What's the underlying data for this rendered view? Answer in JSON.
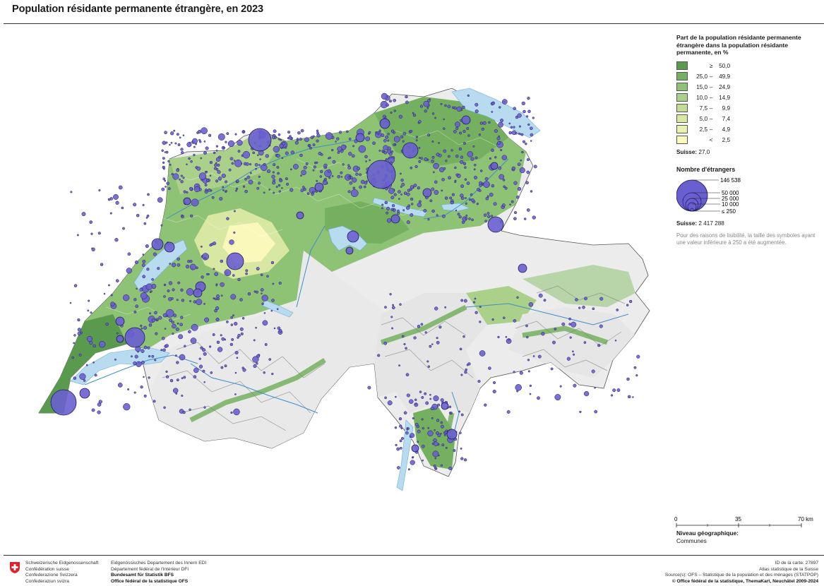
{
  "title": "Population résidante permanente étrangère, en 2023",
  "legend_share": {
    "title": "Part de la population résidante permanente étrangère dans la population résidante permanente, en %",
    "classes": [
      {
        "a": "",
        "op": "≥",
        "b": "50,0",
        "color": "#5a9a4e"
      },
      {
        "a": "25,0",
        "op": "–",
        "b": "49,9",
        "color": "#74b05f"
      },
      {
        "a": "15,0",
        "op": "–",
        "b": "24,9",
        "color": "#8ec274"
      },
      {
        "a": "10,0",
        "op": "–",
        "b": "14,9",
        "color": "#aad08a"
      },
      {
        "a": "7,5",
        "op": "–",
        "b": "9,9",
        "color": "#c4dc98"
      },
      {
        "a": "5,0",
        "op": "–",
        "b": "7,4",
        "color": "#d8e7a2"
      },
      {
        "a": "2,5",
        "op": "–",
        "b": "4,9",
        "color": "#eaf1ad"
      },
      {
        "a": "",
        "op": "<",
        "b": "2,5",
        "color": "#fbf8bc"
      }
    ],
    "total_label": "Suisse:",
    "total_value": "27,0"
  },
  "legend_count": {
    "title": "Nombre d'étrangers",
    "values": [
      "146 538",
      "50 000",
      "25 000",
      "10 000",
      "≤ 250"
    ],
    "total_label": "Suisse:",
    "total_value": "2 417 288",
    "note": "Pour des raisons de lisibilité, la taille des symboles ayant une valeur inférieure à 250 a été augmentée."
  },
  "scale": {
    "ticks": [
      "0",
      "35",
      "70 km"
    ]
  },
  "niveau": {
    "title": "Niveau géographique:",
    "value": "Communes"
  },
  "footer": {
    "col1": [
      "Schweizerische Eidgenossenschaft",
      "Confédération suisse",
      "Confederazione Svizzera",
      "Confederaziun svizra"
    ],
    "col2": [
      "Eidgenössisches Departement des Innern EDI",
      "Département fédéral de l'intérieur DFI",
      "Bundesamt für Statistik BFS",
      "Office fédéral de la statistique OFS"
    ],
    "right": [
      "ID de la carte: 27897",
      "Atlas statistique de la Suisse",
      "Source(s): OFS – Statistique de la population et des ménages (STATPOP)",
      "© Office fédéral de la statistique, ThemaKart, Neuchâtel 2009-2024"
    ]
  },
  "colors": {
    "water": "#b9dbf0",
    "bubble": "#6a5fd0",
    "bubble_stroke": "#1f1b5e",
    "relief": "#e7e7e7"
  }
}
